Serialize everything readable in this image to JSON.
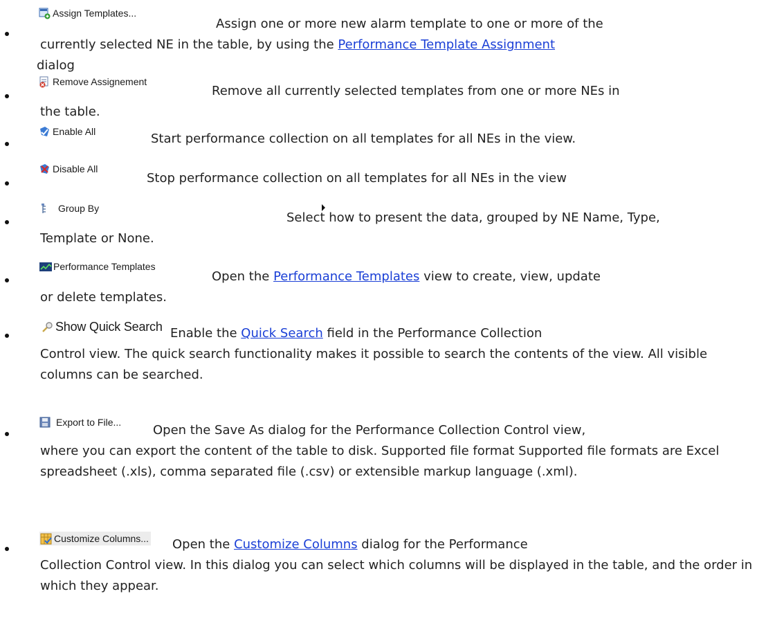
{
  "items": [
    {
      "menu_label": "Assign Templates...",
      "icon": "assign-templates-icon",
      "line1": "Assign one or more new alarm template to one or more of the",
      "rest_before": "currently selected NE in the table, by using the ",
      "link": "Performance Template Assignment",
      "rest_after": " dialog"
    },
    {
      "menu_label": "Remove Assignement",
      "icon": "remove-assignment-icon",
      "line1": "Remove all currently selected templates from one or more NEs in",
      "rest": "the table."
    },
    {
      "menu_label": "Enable All",
      "icon": "enable-all-icon",
      "line1": "Start performance collection on all templates for all NEs in the view."
    },
    {
      "menu_label": "Disable All",
      "icon": "disable-all-icon",
      "line1": "Stop performance collection on all templates for all NEs in the view"
    },
    {
      "menu_label": "Group By",
      "icon": "group-by-icon",
      "line1": "Select how to present the data, grouped by NE Name, Type,",
      "rest": "Template or None."
    },
    {
      "menu_label": "Performance Templates",
      "icon": "performance-templates-icon",
      "line1_before": "Open the ",
      "link": "Performance Templates",
      "line1_after": " view to create, view, update",
      "rest": "or delete templates."
    },
    {
      "menu_label": "Show Quick Search",
      "icon": "quick-search-icon",
      "line1_before": "Enable the ",
      "link": "Quick Search",
      "line1_after": " field in the Performance Collection",
      "rest": "Control view. The quick search functionality makes it possible to search the contents of the view. All visible columns can be searched."
    },
    {
      "menu_label": "Export to File...",
      "icon": "export-to-file-icon",
      "line1": "Open the Save As dialog for the Performance Collection Control view,",
      "rest": "where you can export the content of the table to disk. Supported file format Supported file formats are Excel spreadsheet (.xls), comma separated file (.csv) or extensible markup language (.xml)."
    },
    {
      "menu_label": "Customize Columns...",
      "icon": "customize-columns-icon",
      "line1_before": "Open the ",
      "link": "Customize Columns",
      "line1_after": " dialog for the Performance",
      "rest": "Collection Control view. In this dialog you can select which columns will be displayed in the table, and the order in which they appear."
    }
  ],
  "colors": {
    "text": "#222222",
    "link": "#1a3fd6"
  }
}
